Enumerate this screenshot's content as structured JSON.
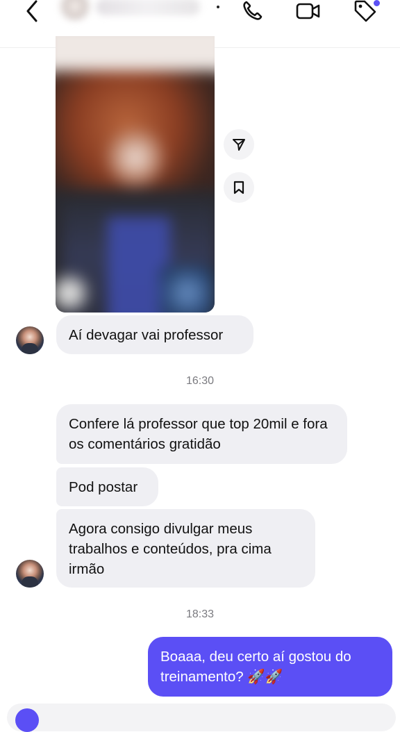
{
  "header": {
    "icons": [
      "back-chevron-icon",
      "phone-icon",
      "video-camera-icon",
      "tag-icon"
    ],
    "accent": "#5b51f5"
  },
  "media": {
    "actions": [
      "send-icon",
      "bookmark-icon"
    ]
  },
  "messages": [
    {
      "direction": "in",
      "text": "Aí devagar vai professor"
    },
    {
      "type": "timestamp",
      "text": "16:30"
    },
    {
      "direction": "in",
      "text": "Confere lá professor que top 20mil e fora os comentários gratidão"
    },
    {
      "direction": "in",
      "text": "Pod postar"
    },
    {
      "direction": "in",
      "text": "Agora consigo divulgar meus trabalhos e conteúdos, pra cima irmão"
    },
    {
      "type": "timestamp",
      "text": "18:33"
    },
    {
      "direction": "out",
      "text": "Boaaa, deu certo aí gostou do treinamento? 🚀🚀"
    }
  ],
  "colors": {
    "incoming_bubble": "#efeff3",
    "outgoing_bubble": "#5b4ff5",
    "timestamp": "#7a7a7f"
  }
}
